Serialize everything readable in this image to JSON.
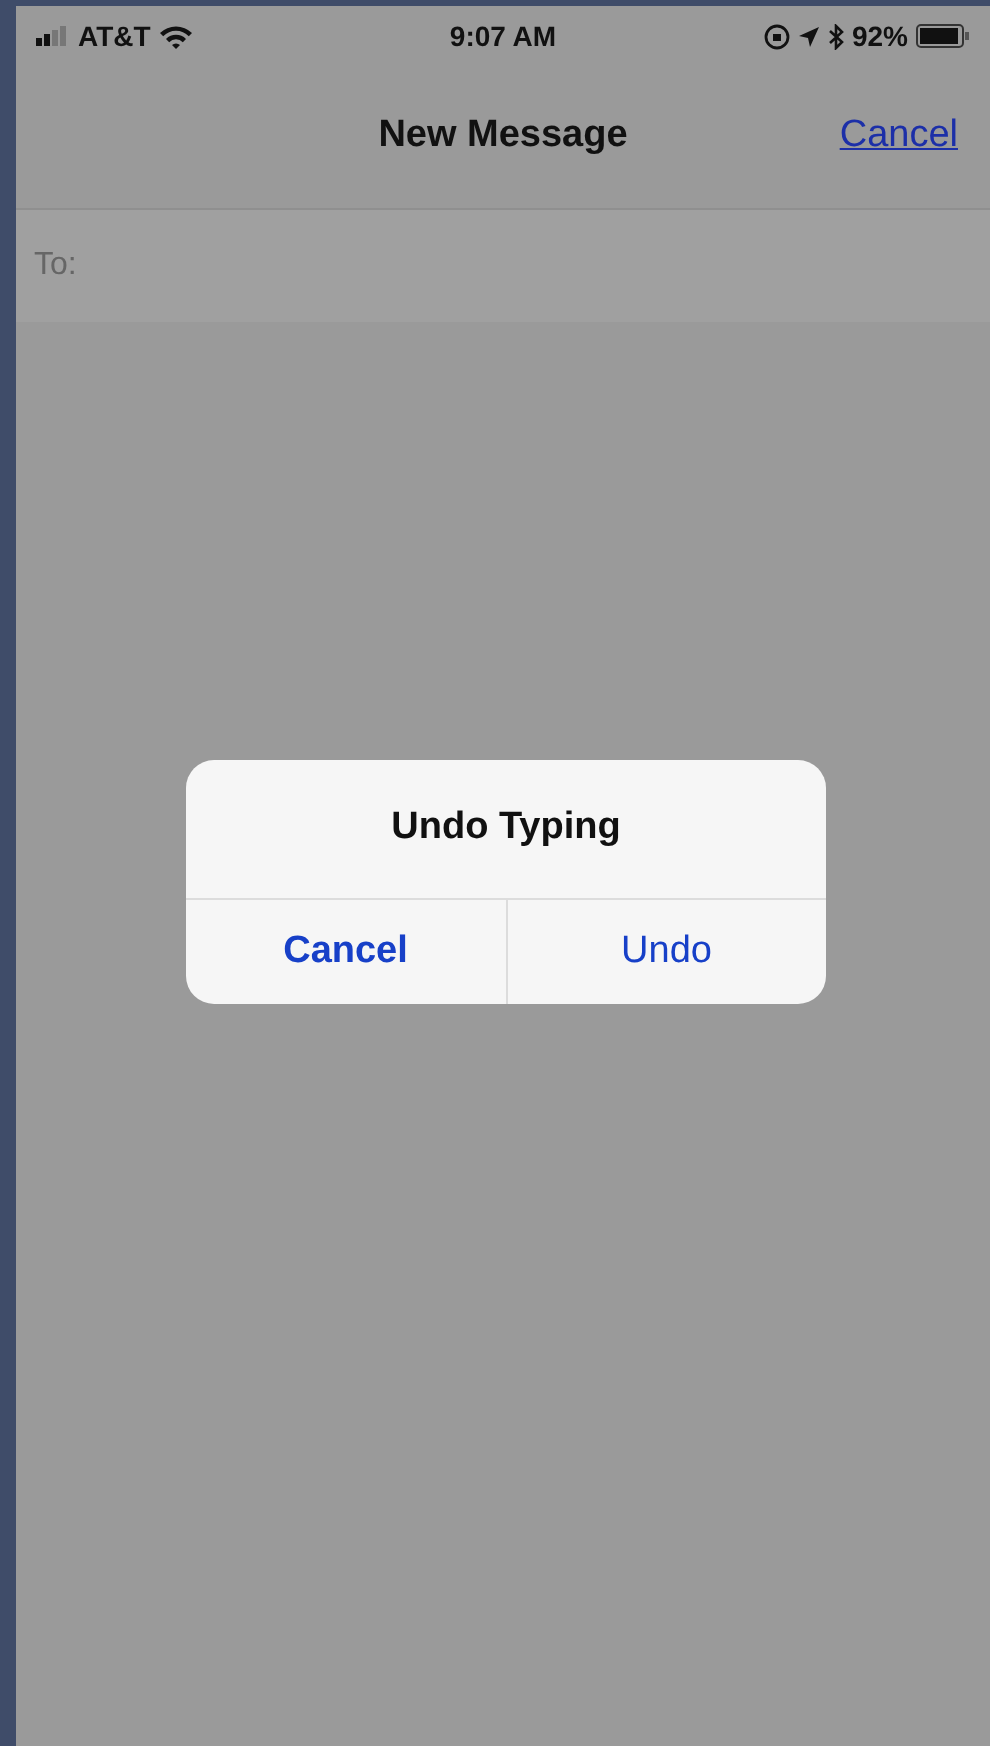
{
  "status_bar": {
    "carrier": "AT&T",
    "time": "9:07 AM",
    "battery": "92%"
  },
  "nav_bar": {
    "title": "New Message",
    "cancel": "Cancel"
  },
  "to_field": {
    "label": "To:"
  },
  "alert": {
    "title": "Undo Typing",
    "buttons": [
      {
        "label": "Cancel",
        "preferred": true
      },
      {
        "label": "Undo",
        "preferred": false
      }
    ]
  }
}
